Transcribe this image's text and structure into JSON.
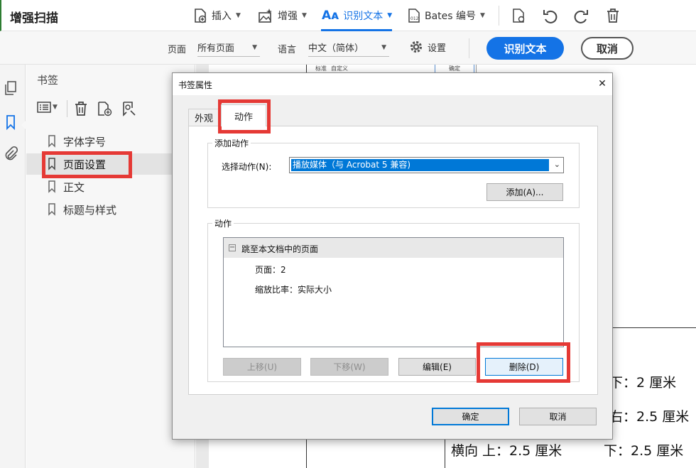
{
  "toolbar": {
    "title": "增强扫描",
    "insert_label": "插入",
    "enhance_label": "增强",
    "recognize_label": "识别文本",
    "bates_label": "Bates 编号"
  },
  "subbar": {
    "page_label": "页面",
    "page_value": "所有页面",
    "lang_label": "语言",
    "lang_value": "中文（简体）",
    "settings_label": "设置",
    "recognize_button": "识别文本",
    "cancel_button": "取消"
  },
  "bookmarks": {
    "title": "书签",
    "items": [
      {
        "label": "字体字号"
      },
      {
        "label": "页面设置"
      },
      {
        "label": "正文"
      },
      {
        "label": "标题与样式"
      }
    ]
  },
  "doc": {
    "top_labels": [
      "标准",
      "自定义",
      "确定"
    ],
    "lines": [
      "下：2 厘米",
      "右：2.5 厘米",
      "横向  上：2.5 厘米",
      "下：2.5 厘米"
    ]
  },
  "dialog": {
    "title": "书签属性",
    "close_glyph": "✕",
    "tabs": [
      "外观",
      "动作"
    ],
    "add_action_group": "添加动作",
    "select_action_label": "选择动作(N):",
    "select_action_value": "播放媒体（与 Acrobat 5 兼容)",
    "add_button": "添加(A)...",
    "actions_group": "动作",
    "tree_root": "跳至本文档中的页面",
    "tree_page": "页面：2",
    "tree_zoom": "缩放比率：实际大小",
    "move_up": "上移(U)",
    "move_down": "下移(W)",
    "edit": "编辑(E)",
    "delete": "删除(D)",
    "ok": "确定",
    "cancel": "取消"
  },
  "colors": {
    "accent": "#1473e6",
    "highlight_red": "#e53935",
    "selection_blue": "#0078d7"
  }
}
